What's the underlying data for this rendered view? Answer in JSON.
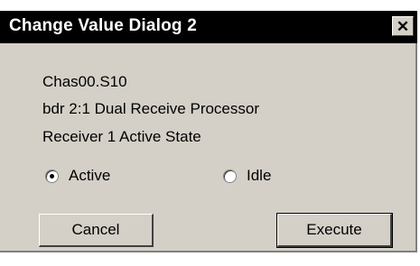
{
  "window": {
    "title": "Change Value Dialog 2",
    "close_glyph": "✕"
  },
  "info": {
    "line1": "Chas00.S10",
    "line2": "bdr 2:1 Dual Receive Processor",
    "line3": "Receiver 1 Active State"
  },
  "options": {
    "active_label": "Active",
    "idle_label": "Idle",
    "selected": "Active"
  },
  "buttons": {
    "cancel_label": "Cancel",
    "execute_label": "Execute"
  }
}
